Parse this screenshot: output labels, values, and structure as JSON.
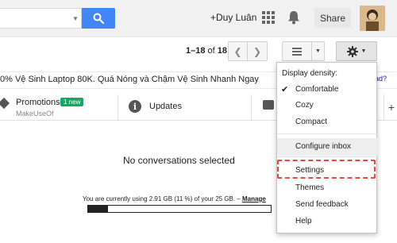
{
  "header": {
    "user_name": "+Duy Luân",
    "share_label": "Share",
    "search_placeholder": ""
  },
  "toolbar": {
    "pager_range": "1–18",
    "pager_of": "of",
    "pager_total": "18"
  },
  "ad": {
    "text": "0% Vệ Sinh Laptop 80K. Quá Nóng và Chậm Vệ Sinh Nhanh Ngay",
    "link": "ad?"
  },
  "tabs": {
    "promotions": {
      "label": "Promotions",
      "badge": "1 new",
      "sender": "MakeUseOf"
    },
    "updates": {
      "label": "Updates"
    }
  },
  "main": {
    "empty_message": "No conversations selected",
    "storage_text": "You are currently using 2.91 GB (11 %) of your 25 GB. –",
    "storage_link": "Manage",
    "storage_fraction": 0.11
  },
  "menu": {
    "header": "Display density:",
    "density_options": [
      "Comfortable",
      "Cozy",
      "Compact"
    ],
    "selected_density": "Comfortable",
    "items": [
      "Configure inbox",
      "Settings",
      "Themes",
      "Send feedback",
      "Help"
    ],
    "highlighted_item": "Configure inbox",
    "outlined_item": "Settings"
  },
  "colors": {
    "search_button": "#4285f4",
    "new_badge": "#16a765",
    "outline": "#e8493b"
  },
  "icons": [
    "search-icon",
    "apps-icon",
    "bell-icon",
    "chevron-left-icon",
    "chevron-right-icon",
    "density-icon",
    "gear-icon",
    "tag-icon",
    "info-icon",
    "chat-icon",
    "plus-icon",
    "checkmark-icon"
  ]
}
